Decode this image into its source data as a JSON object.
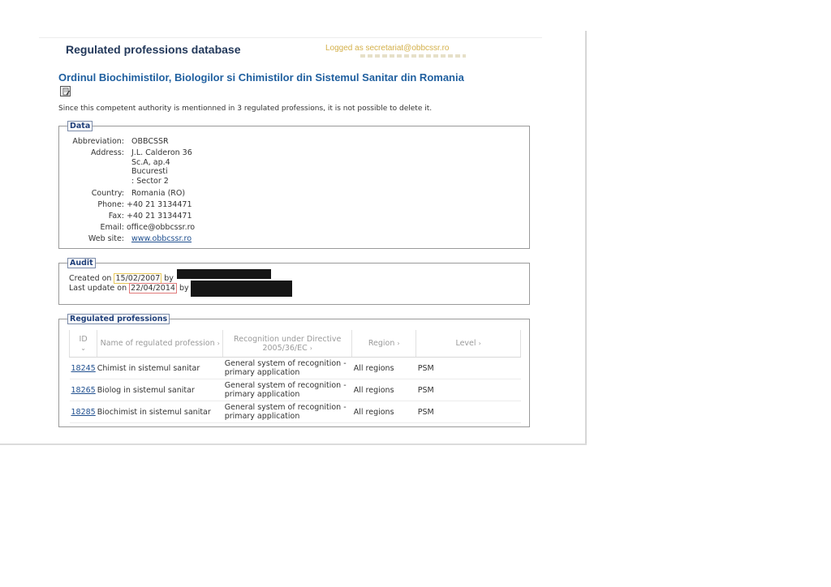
{
  "header": {
    "app_title": "Regulated professions database",
    "logged_as": "Logged as secretariat@obbcssr.ro"
  },
  "authority": {
    "title": "Ordinul Biochimistilor, Biologilor si Chimistilor din Sistemul Sanitar din Romania",
    "edit_icon": "edit-note-icon",
    "notice": "Since this competent authority is mentionned in 3 regulated professions, it is not possible to delete it."
  },
  "data_section": {
    "legend": "Data",
    "labels": {
      "abbreviation": "Abbreviation:",
      "address": "Address:",
      "country": "Country:",
      "phone": "Phone:",
      "fax": "Fax:",
      "email": "Email:",
      "website": "Web site:"
    },
    "values": {
      "abbreviation": "OBBCSSR",
      "address_lines": [
        "J.L. Calderon 36",
        "Sc.A, ap.4",
        "Bucuresti",
        ":   Sector 2"
      ],
      "country": "Romania (RO)",
      "phone": "+40 21 3134471",
      "fax": "+40 21 3134471",
      "email": "office@obbcssr.ro",
      "website": "www.obbcssr.ro"
    }
  },
  "audit_section": {
    "legend": "Audit",
    "created_prefix": "Created on",
    "created_date": "15/02/2007",
    "created_by": "by",
    "updated_prefix": "Last update on",
    "updated_date": "22/04/2014",
    "updated_by": "by"
  },
  "professions_section": {
    "legend": "Regulated professions",
    "columns": [
      {
        "label": "ID",
        "arrow": "⌄"
      },
      {
        "label": "Name of regulated profession",
        "arrow": "›"
      },
      {
        "label": "Recognition under Directive 2005/36/EC",
        "arrow": "›"
      },
      {
        "label": "Region",
        "arrow": "›"
      },
      {
        "label": "Level",
        "arrow": "›"
      }
    ],
    "rows": [
      {
        "id": "18245",
        "name": "Chimist in sistemul sanitar",
        "recognition": "General system of recognition - primary application",
        "region": "All regions",
        "level": "PSM"
      },
      {
        "id": "18265",
        "name": "Biolog in sistemul sanitar",
        "recognition": "General system of recognition - primary application",
        "region": "All regions",
        "level": "PSM"
      },
      {
        "id": "18285",
        "name": "Biochimist in sistemul sanitar",
        "recognition": "General system of recognition - primary application",
        "region": "All regions",
        "level": "PSM"
      }
    ]
  },
  "colors": {
    "created_highlight": "#e8c85a",
    "updated_highlight": "#e07a7a"
  }
}
